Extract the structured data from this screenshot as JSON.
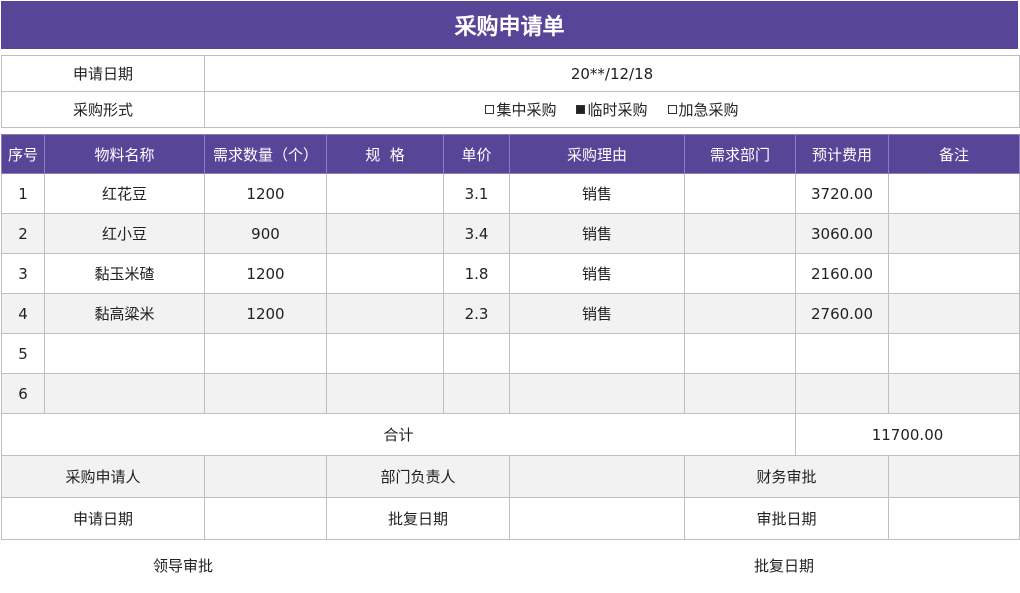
{
  "title": "采购申请单",
  "info": {
    "date_label": "申请日期",
    "date_value": "20**/12/18",
    "form_label": "采购形式",
    "options": [
      {
        "label": "集中采购",
        "checked": false
      },
      {
        "label": "临时采购",
        "checked": true
      },
      {
        "label": "加急采购",
        "checked": false
      }
    ]
  },
  "columns": [
    "序号",
    "物料名称",
    "需求数量（个）",
    "规  格",
    "单价",
    "采购理由",
    "需求部门",
    "预计费用",
    "备注"
  ],
  "rows": [
    {
      "no": "1",
      "name": "红花豆",
      "qty": "1200",
      "spec": "",
      "price": "3.1",
      "reason": "销售",
      "dept": "",
      "cost": "3720.00",
      "note": ""
    },
    {
      "no": "2",
      "name": "红小豆",
      "qty": "900",
      "spec": "",
      "price": "3.4",
      "reason": "销售",
      "dept": "",
      "cost": "3060.00",
      "note": ""
    },
    {
      "no": "3",
      "name": "黏玉米碴",
      "qty": "1200",
      "spec": "",
      "price": "1.8",
      "reason": "销售",
      "dept": "",
      "cost": "2160.00",
      "note": ""
    },
    {
      "no": "4",
      "name": "黏高粱米",
      "qty": "1200",
      "spec": "",
      "price": "2.3",
      "reason": "销售",
      "dept": "",
      "cost": "2760.00",
      "note": ""
    },
    {
      "no": "5",
      "name": "",
      "qty": "",
      "spec": "",
      "price": "",
      "reason": "",
      "dept": "",
      "cost": "",
      "note": ""
    },
    {
      "no": "6",
      "name": "",
      "qty": "",
      "spec": "",
      "price": "",
      "reason": "",
      "dept": "",
      "cost": "",
      "note": ""
    }
  ],
  "total": {
    "label": "合计",
    "value": "11700.00"
  },
  "signatures": {
    "applicant": "采购申请人",
    "dept_head": "部门负责人",
    "finance": "财务审批",
    "apply_date": "申请日期",
    "approve_date": "批复日期",
    "review_date": "审批日期"
  },
  "footer": {
    "leader": "领导审批",
    "reply_date": "批复日期"
  }
}
